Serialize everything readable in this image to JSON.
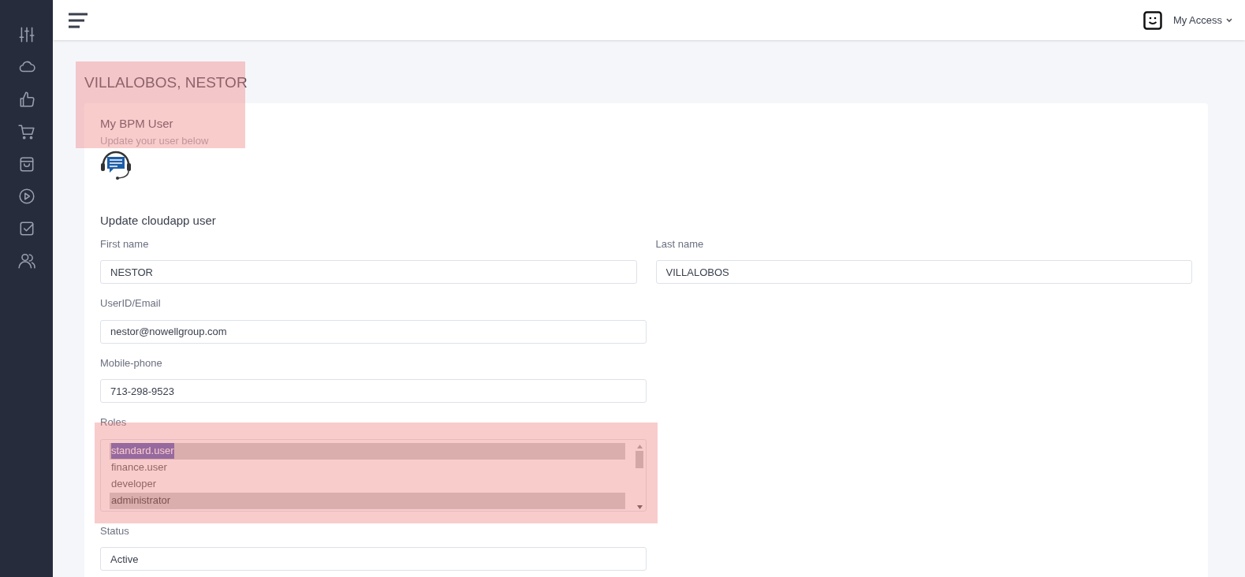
{
  "header": {
    "account_menu": "My Access"
  },
  "page_title": "VILLALOBOS, NESTOR",
  "card": {
    "title": "My BPM User",
    "subtitle": "Update your user below",
    "section_title": "Update cloudapp user",
    "fields": [
      {
        "label": "First name",
        "value": "NESTOR",
        "kind": "half"
      },
      {
        "label": "Last name",
        "value": "VILLALOBOS",
        "kind": "half"
      },
      {
        "label": "UserID/Email",
        "value": "nestor@nowellgroup.com",
        "kind": "full"
      },
      {
        "label": "Mobile-phone",
        "value": "713-298-9523",
        "kind": "full"
      },
      {
        "label": "Roles",
        "kind": "list",
        "options": [
          {
            "label": "standard.user",
            "selected": true,
            "focused": true
          },
          {
            "label": "finance.user",
            "selected": false,
            "focused": false
          },
          {
            "label": "developer",
            "selected": false,
            "focused": false
          },
          {
            "label": "administrator",
            "selected": true,
            "focused": false
          }
        ]
      },
      {
        "label": "Status",
        "value": "Active",
        "kind": "full"
      }
    ]
  }
}
